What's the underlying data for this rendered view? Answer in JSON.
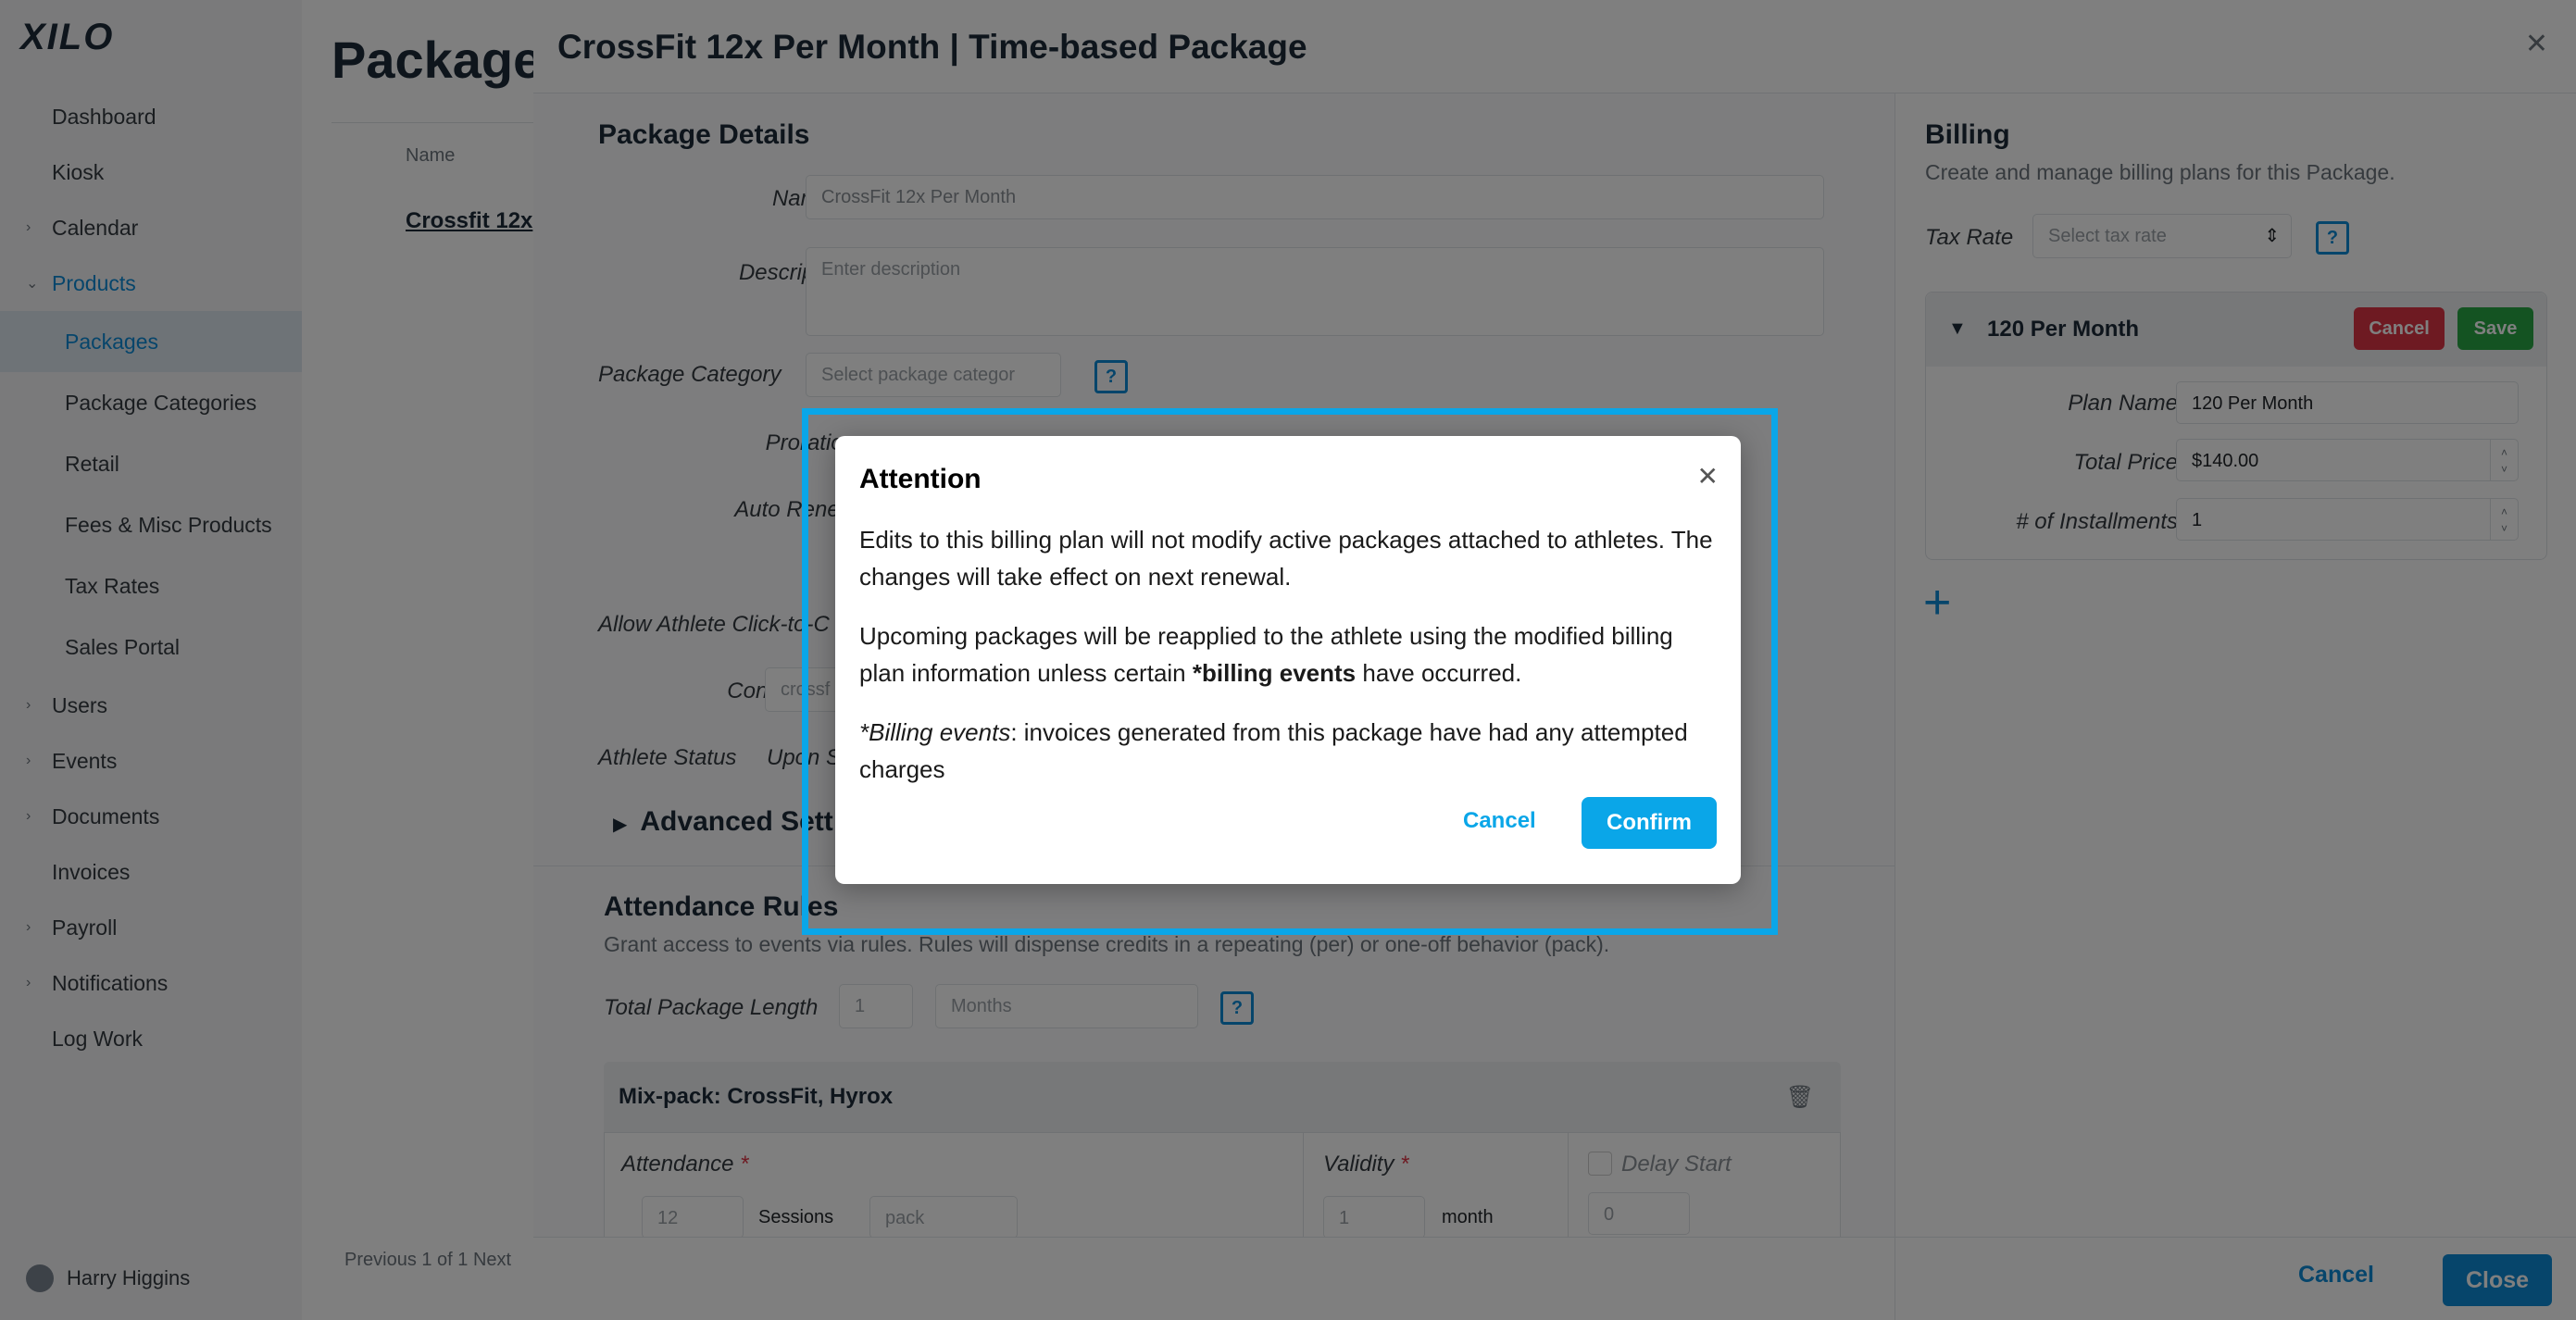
{
  "sidebar": {
    "logo": "XILO",
    "items": [
      {
        "label": "Dashboard"
      },
      {
        "label": "Kiosk"
      },
      {
        "label": "Calendar"
      },
      {
        "label": "Products"
      },
      {
        "label": "Packages"
      },
      {
        "label": "Package Categories"
      },
      {
        "label": "Retail"
      },
      {
        "label": "Fees & Misc Products"
      },
      {
        "label": "Tax Rates"
      },
      {
        "label": "Sales Portal"
      },
      {
        "label": "Users"
      },
      {
        "label": "Events"
      },
      {
        "label": "Documents"
      },
      {
        "label": "Invoices"
      },
      {
        "label": "Payroll"
      },
      {
        "label": "Notifications"
      },
      {
        "label": "Log Work"
      }
    ],
    "user": "Harry Higgins"
  },
  "background_page": {
    "title": "Packages",
    "table_header": "Name",
    "table_row": "Crossfit 12x",
    "pager": "Previous 1 of 1 Next"
  },
  "drawer": {
    "title": "CrossFit 12x Per Month | Time-based Package",
    "details": {
      "heading": "Package Details",
      "name_label": "Name",
      "name_value": "CrossFit 12x Per Month",
      "description_label": "Description",
      "description_placeholder": "Enter description",
      "category_label": "Package Category",
      "category_placeholder": "Select package categor",
      "proration_label": "Proration",
      "auto_renew_label": "Auto Renew",
      "allow_label": "Allow Athlete Click-to-C",
      "contract_label": "Contract",
      "contract_value": "crossf",
      "athlete_status_label": "Athlete Status",
      "athlete_status_value": "Upon S",
      "advanced_label": "Advanced Sett",
      "help_mark": "?"
    },
    "attendance": {
      "heading": "Attendance Rules",
      "subtitle": "Grant access to events via rules. Rules will dispense credits in a repeating (per) or one-off behavior (pack).",
      "length_label": "Total Package Length",
      "length_value": "1",
      "length_unit": "Months",
      "mix_title": "Mix-pack: CrossFit, Hyrox",
      "attendance_label": "Attendance",
      "attendance_value": "12",
      "sessions": "Sessions",
      "pack": "pack",
      "validity_label": "Validity",
      "validity_value": "1",
      "validity_unit": "month",
      "delay_label": "Delay Start",
      "delay_value": "0"
    },
    "billing": {
      "heading": "Billing",
      "subtitle": "Create and manage billing plans for this Package.",
      "tax_label": "Tax Rate",
      "tax_placeholder": "Select tax rate",
      "plan": {
        "title": "120 Per Month",
        "cancel": "Cancel",
        "save": "Save",
        "plan_name_label": "Plan Name",
        "plan_name_value": "120 Per Month",
        "total_price_label": "Total Price",
        "total_price_value": "$140.00",
        "installments_label": "# of Installments",
        "installments_value": "1"
      },
      "add": "+"
    },
    "footer": {
      "cancel": "Cancel",
      "close": "Close"
    }
  },
  "modal": {
    "title": "Attention",
    "p1": "Edits to this billing plan will not modify active packages attached to athletes. The changes will take effect on next renewal.",
    "p2_pre": "Upcoming packages will be reapplied to the athlete using the modified billing plan information unless certain ",
    "p2_bold": "*billing events",
    "p2_post": " have occurred.",
    "p3_em": "*Billing events",
    "p3_rest": ": invoices generated from this package have had any attempted charges",
    "cancel": "Cancel",
    "confirm": "Confirm"
  }
}
